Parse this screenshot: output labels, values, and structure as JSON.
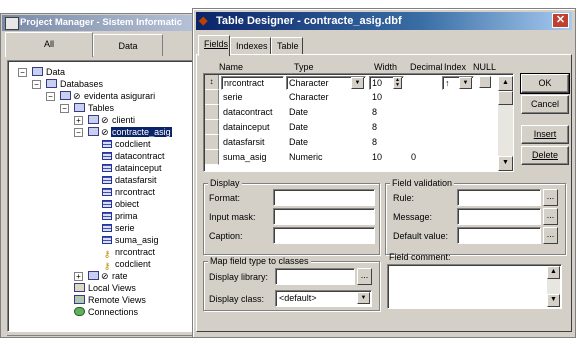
{
  "project_manager": {
    "title": "Project Manager - Sistem Informatic",
    "tabs": [
      "All",
      "Data"
    ],
    "tree": {
      "data": "Data",
      "databases": "Databases",
      "database": "evidenta asigurari",
      "tables": "Tables",
      "table1": "clienti",
      "table2": "contracte_asig",
      "fields": [
        "codclient",
        "datacontract",
        "datainceput",
        "datasfarsit",
        "nrcontract",
        "obiect",
        "prima",
        "serie",
        "suma_asig",
        "nrcontract",
        "codclient"
      ],
      "table3": "rate",
      "local_views": "Local Views",
      "remote_views": "Remote Views",
      "connections": "Connections"
    }
  },
  "table_designer": {
    "title": "Table Designer - contracte_asig.dbf",
    "close_glyph": "✕",
    "tabs": [
      "Fields",
      "Indexes",
      "Table"
    ],
    "columns": {
      "name": "Name",
      "type": "Type",
      "width": "Width",
      "decimal": "Decimal",
      "index": "Index",
      "null": "NULL"
    },
    "rows": [
      {
        "name": "nrcontract",
        "type": "Character",
        "width": "10",
        "decimal": "",
        "index": "↑"
      },
      {
        "name": "serie",
        "type": "Character",
        "width": "10",
        "decimal": ""
      },
      {
        "name": "datacontract",
        "type": "Date",
        "width": "8",
        "decimal": ""
      },
      {
        "name": "datainceput",
        "type": "Date",
        "width": "8",
        "decimal": ""
      },
      {
        "name": "datasfarsit",
        "type": "Date",
        "width": "8",
        "decimal": ""
      },
      {
        "name": "suma_asig",
        "type": "Numeric",
        "width": "10",
        "decimal": "0"
      }
    ],
    "buttons": {
      "ok": "OK",
      "cancel": "Cancel",
      "insert": "Insert",
      "delete": "Delete"
    },
    "display": {
      "label": "Display",
      "format": "Format:",
      "input_mask": "Input mask:",
      "caption": "Caption:"
    },
    "field_validation": {
      "label": "Field validation",
      "rule": "Rule:",
      "message": "Message:",
      "default_value": "Default value:"
    },
    "map_field": {
      "label": "Map field type to classes",
      "display_library": "Display library:",
      "display_class": "Display class:",
      "display_class_value": "<default>"
    },
    "field_comment": "Field comment:",
    "dots": "..."
  },
  "colors": {
    "title_active": "#0a246a",
    "selection": "#0a246a",
    "face": "#d4d0c8"
  }
}
